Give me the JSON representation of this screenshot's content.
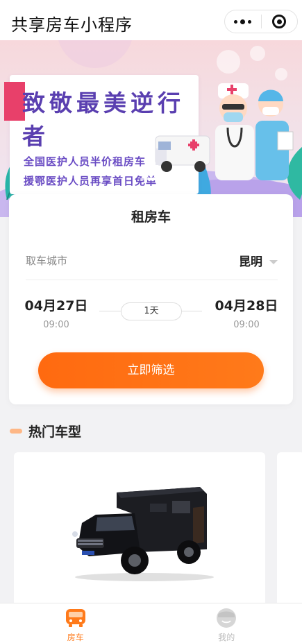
{
  "navbar": {
    "title": "共享房车小程序",
    "more_icon": "more-dots-icon",
    "close_icon": "target-close-icon"
  },
  "banner": {
    "title": "致敬最美逆行者",
    "line1": "全国医护人员半价租房车",
    "line2": "援鄂医护人员再享首日免单",
    "pager_count": 3,
    "pager_active": 1
  },
  "booking": {
    "title": "租房车",
    "city_label": "取车城市",
    "city_value": "昆明",
    "start_date": "04月27日",
    "start_time": "09:00",
    "duration": "1天",
    "end_date": "04月28日",
    "end_time": "09:00",
    "filter_button": "立即筛选"
  },
  "hot_models": {
    "title": "热门车型"
  },
  "tabbar": {
    "items": [
      {
        "label": "房车",
        "icon": "bus-icon",
        "active": true
      },
      {
        "label": "我的",
        "icon": "user-icon",
        "active": false
      }
    ]
  },
  "colors": {
    "accent": "#ff7a1a",
    "banner_purple": "#5a3fb0",
    "banner_pink": "#f7d8dc"
  }
}
